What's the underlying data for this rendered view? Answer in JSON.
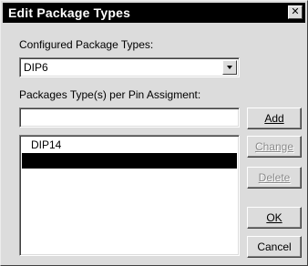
{
  "window": {
    "title": "Edit Package Types",
    "close_glyph": "✕"
  },
  "configured": {
    "label": "Configured Package Types:",
    "selected_value": "DIP6"
  },
  "pin_assignment": {
    "label": "Packages Type(s) per Pin Assigment:",
    "value": ""
  },
  "package_list": {
    "items": [
      "DIP14",
      ""
    ],
    "selected_index": 1
  },
  "buttons": {
    "add": {
      "label": "Add",
      "enabled": true
    },
    "change": {
      "label": "Change",
      "enabled": false
    },
    "delete": {
      "label": "Delete",
      "enabled": false
    },
    "ok": {
      "label": "OK",
      "enabled": true
    },
    "cancel": {
      "label": "Cancel",
      "enabled": true
    }
  },
  "icons": {
    "close": "close-icon",
    "combo_arrow": "chevron-down-icon"
  }
}
